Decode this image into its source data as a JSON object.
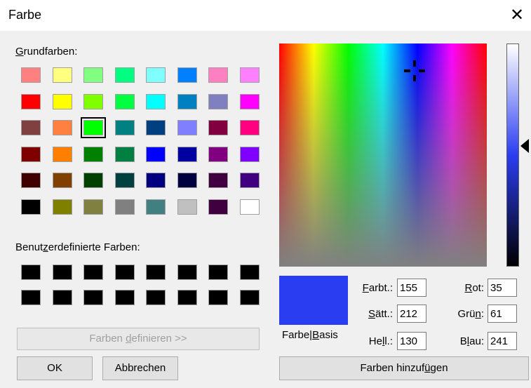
{
  "window": {
    "title": "Farbe",
    "close_glyph": "✕"
  },
  "basic_colors": {
    "label_first": "G",
    "label_rest": "rundfarben:",
    "selected": "#00ff00",
    "rows": [
      [
        "#ff8080",
        "#ffff80",
        "#80ff80",
        "#00ff80",
        "#80ffff",
        "#0080ff",
        "#ff80c0",
        "#ff80ff"
      ],
      [
        "#ff0000",
        "#ffff00",
        "#80ff00",
        "#00ff40",
        "#00ffff",
        "#0080c0",
        "#8080c0",
        "#ff00ff"
      ],
      [
        "#804040",
        "#ff8040",
        "#00ff00",
        "#008080",
        "#004080",
        "#8080ff",
        "#800040",
        "#ff0080"
      ],
      [
        "#800000",
        "#ff8000",
        "#008000",
        "#008040",
        "#0000ff",
        "#0000a0",
        "#800080",
        "#8000ff"
      ],
      [
        "#400000",
        "#804000",
        "#004000",
        "#004040",
        "#000080",
        "#000040",
        "#400040",
        "#400080"
      ],
      [
        "#000000",
        "#808000",
        "#808040",
        "#808080",
        "#408080",
        "#c0c0c0",
        "#400040",
        "#ffffff"
      ]
    ]
  },
  "custom_colors": {
    "label_a": "Benut",
    "label_u": "z",
    "label_b": "erdefinierte Farben:",
    "rows": [
      [
        "#000000",
        "#000000",
        "#000000",
        "#000000",
        "#000000",
        "#000000",
        "#000000",
        "#000000"
      ],
      [
        "#000000",
        "#000000",
        "#000000",
        "#000000",
        "#000000",
        "#000000",
        "#000000",
        "#000000"
      ]
    ]
  },
  "buttons": {
    "define": {
      "a": "Farben ",
      "u": "d",
      "b": "efinieren >>"
    },
    "ok": "OK",
    "cancel": "Abbrechen",
    "add": {
      "a": "Farben hinzuf",
      "u": "ü",
      "b": "gen"
    }
  },
  "preview": {
    "label_a": "Farbe|",
    "label_u": "B",
    "label_b": "asis",
    "color": "#2a3df1"
  },
  "fields": {
    "hue": {
      "u": "F",
      "rest": "arbt.:",
      "value": "155"
    },
    "sat": {
      "u": "S",
      "rest": "ätt.:",
      "value": "212"
    },
    "lum": {
      "a": "He",
      "u": "l",
      "b": "l.:",
      "value": "130"
    },
    "red": {
      "u": "R",
      "rest": "ot:",
      "value": "35"
    },
    "green": {
      "a": "Grü",
      "u": "n",
      "b": ":",
      "value": "61"
    },
    "blue": {
      "a": "B",
      "u": "l",
      "b": "au:",
      "value": "241"
    }
  },
  "icons": {
    "close": "close-icon",
    "crosshair": "crosshair-icon",
    "arrow": "luminance-arrow-icon"
  }
}
